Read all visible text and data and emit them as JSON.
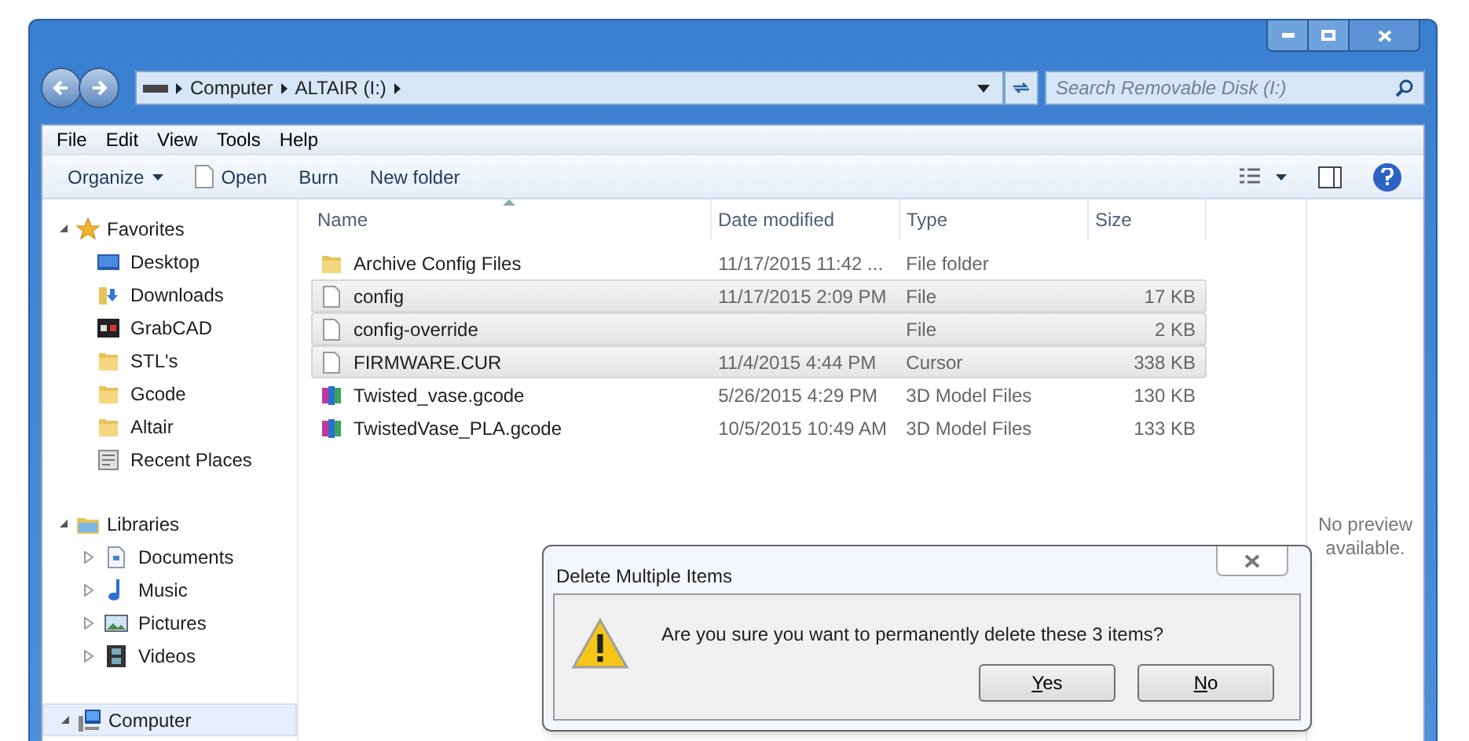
{
  "address_bar": {
    "crumbs": [
      "Computer",
      "ALTAIR (I:)"
    ],
    "search_placeholder": "Search Removable Disk (I:)"
  },
  "menu": [
    "File",
    "Edit",
    "View",
    "Tools",
    "Help"
  ],
  "toolbar": [
    {
      "label": "Organize",
      "kind": "dropdown"
    },
    {
      "label": "Open",
      "kind": "open"
    },
    {
      "label": "Burn",
      "kind": "plain"
    },
    {
      "label": "New folder",
      "kind": "plain"
    }
  ],
  "sidebar": [
    {
      "label": "Favorites",
      "kind": "star",
      "expanded": true,
      "selected": false,
      "children": [
        {
          "label": "Desktop",
          "kind": "desktop"
        },
        {
          "label": "Downloads",
          "kind": "downloads"
        },
        {
          "label": "GrabCAD",
          "kind": "grabcad"
        },
        {
          "label": "STL's",
          "kind": "folder"
        },
        {
          "label": "Gcode",
          "kind": "folder"
        },
        {
          "label": "Altair",
          "kind": "folder"
        },
        {
          "label": "Recent Places",
          "kind": "recent"
        }
      ]
    },
    {
      "label": "Libraries",
      "kind": "library",
      "expanded": true,
      "selected": false,
      "children": [
        {
          "label": "Documents",
          "kind": "documents",
          "expanded": false
        },
        {
          "label": "Music",
          "kind": "music",
          "expanded": false
        },
        {
          "label": "Pictures",
          "kind": "pictures",
          "expanded": false
        },
        {
          "label": "Videos",
          "kind": "videos",
          "expanded": false
        }
      ]
    },
    {
      "label": "Computer",
      "kind": "computer",
      "expanded": true,
      "selected": true
    }
  ],
  "table": {
    "columns": [
      "Name",
      "Date modified",
      "Type",
      "Size"
    ],
    "rows": [
      {
        "name": "Archive Config Files",
        "date": "11/17/2015 11:42 ...",
        "type": "File folder",
        "size": "",
        "kind": "folder",
        "selected": false
      },
      {
        "name": "config",
        "date": "11/17/2015 2:09 PM",
        "type": "File",
        "size": "17 KB",
        "kind": "file",
        "selected": true
      },
      {
        "name": "config-override",
        "date": "",
        "type": "File",
        "size": "2 KB",
        "kind": "file",
        "selected": true
      },
      {
        "name": "FIRMWARE.CUR",
        "date": "11/4/2015 4:44 PM",
        "type": "Cursor",
        "size": "338 KB",
        "kind": "file",
        "selected": true
      },
      {
        "name": "Twisted_vase.gcode",
        "date": "5/26/2015 4:29 PM",
        "type": "3D Model Files",
        "size": "130 KB",
        "kind": "model",
        "selected": false
      },
      {
        "name": "TwistedVase_PLA.gcode",
        "date": "10/5/2015 10:49 AM",
        "type": "3D Model Files",
        "size": "133 KB",
        "kind": "model",
        "selected": false
      }
    ]
  },
  "preview": "No preview available.",
  "dialog": {
    "title": "Delete Multiple Items",
    "message": "Are you sure you want to permanently delete these 3 items?",
    "buttons": [
      "Yes",
      "No"
    ]
  }
}
